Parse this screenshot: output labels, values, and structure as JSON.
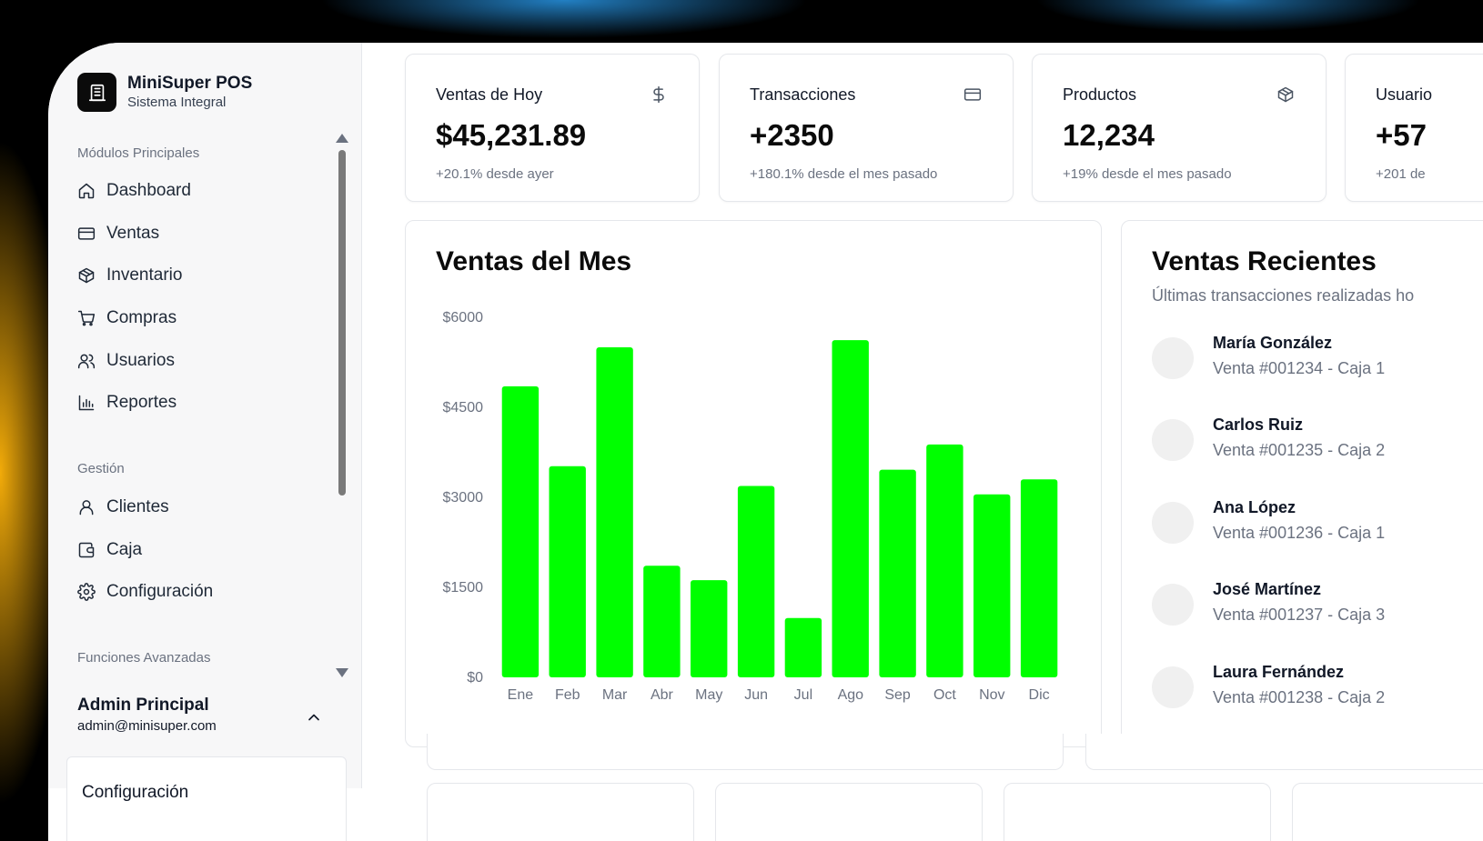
{
  "brand": {
    "title": "MiniSuper POS",
    "subtitle": "Sistema Integral",
    "icon": "store-icon"
  },
  "sidebar": {
    "sections": [
      {
        "label": "Módulos Principales"
      },
      {
        "label": "Gestión"
      },
      {
        "label": "Funciones Avanzadas"
      }
    ],
    "items": [
      {
        "label": "Dashboard",
        "icon": "home-icon"
      },
      {
        "label": "Ventas",
        "icon": "credit-card-icon"
      },
      {
        "label": "Inventario",
        "icon": "package-icon"
      },
      {
        "label": "Compras",
        "icon": "cart-icon"
      },
      {
        "label": "Usuarios",
        "icon": "users-icon"
      },
      {
        "label": "Reportes",
        "icon": "bar-chart-icon"
      },
      {
        "label": "Clientes",
        "icon": "user-icon"
      },
      {
        "label": "Caja",
        "icon": "wallet-icon"
      },
      {
        "label": "Configuración",
        "icon": "gear-icon"
      }
    ]
  },
  "user": {
    "name": "Admin Principal",
    "email": "admin@minisuper.com"
  },
  "popup": {
    "item": "Configuración"
  },
  "stats": [
    {
      "title": "Ventas de Hoy",
      "value": "$45,231.89",
      "sub": "+20.1% desde ayer",
      "icon": "dollar-icon"
    },
    {
      "title": "Transacciones",
      "value": "+2350",
      "sub": "+180.1% desde el mes pasado",
      "icon": "credit-card-icon"
    },
    {
      "title": "Productos",
      "value": "12,234",
      "sub": "+19% desde el mes pasado",
      "icon": "package-icon"
    },
    {
      "title": "Usuario",
      "value": "+57",
      "sub": "+201 de",
      "icon": "users-icon"
    }
  ],
  "sales_chart": {
    "title": "Ventas del Mes"
  },
  "recent_sales": {
    "title": "Ventas Recientes",
    "subtitle": "Últimas transacciones realizadas ho",
    "items": [
      {
        "name": "María González",
        "desc": "Venta #001234 - Caja 1"
      },
      {
        "name": "Carlos Ruiz",
        "desc": "Venta #001235 - Caja 2"
      },
      {
        "name": "Ana López",
        "desc": "Venta #001236 - Caja 1"
      },
      {
        "name": "José Martínez",
        "desc": "Venta #001237 - Caja 3"
      },
      {
        "name": "Laura Fernández",
        "desc": "Venta #001238 - Caja 2"
      }
    ]
  },
  "colors": {
    "bar": "#00ff00",
    "accent": "#0b0b0b"
  },
  "chart_data": {
    "type": "bar",
    "title": "Ventas del Mes",
    "categories": [
      "Ene",
      "Feb",
      "Mar",
      "Abr",
      "May",
      "Jun",
      "Jul",
      "Ago",
      "Sep",
      "Oct",
      "Nov",
      "Dic"
    ],
    "values": [
      4850,
      3520,
      5500,
      1860,
      1620,
      3190,
      990,
      5620,
      3460,
      3880,
      3050,
      3300
    ],
    "ylim": [
      0,
      6000
    ],
    "yticks": [
      0,
      1500,
      3000,
      4500,
      6000
    ],
    "ytick_labels": [
      "$0",
      "$1500",
      "$3000",
      "$4500",
      "$6000"
    ],
    "grid": false
  }
}
